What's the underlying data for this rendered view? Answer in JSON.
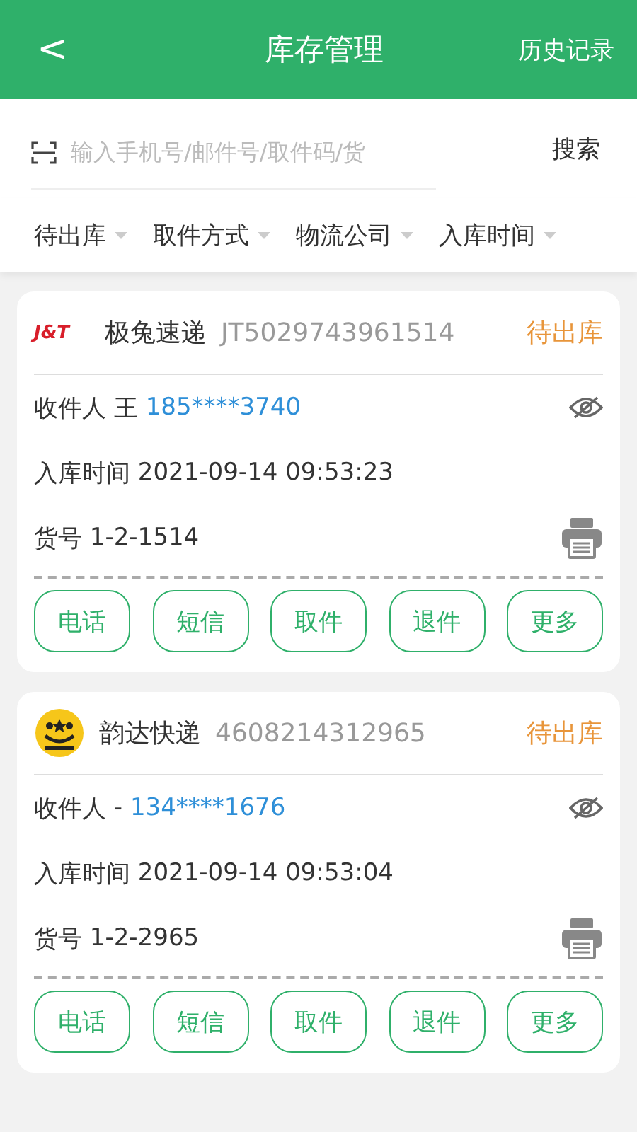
{
  "header": {
    "back": "<",
    "title": "库存管理",
    "action": "历史记录"
  },
  "search": {
    "placeholder": "输入手机号/邮件号/取件码/货",
    "button": "搜索"
  },
  "filters": [
    {
      "label": "待出库"
    },
    {
      "label": "取件方式"
    },
    {
      "label": "物流公司"
    },
    {
      "label": "入库时间"
    }
  ],
  "cards": [
    {
      "logo": {
        "kind": "jt",
        "text": "J&T"
      },
      "courier": "极兔速递",
      "tracking": "JT5029743961514",
      "status": "待出库",
      "recipient_label": "收件人",
      "recipient_name": "王",
      "phone": "185****3740",
      "time_label": "入库时间",
      "time": "2021-09-14 09:53:23",
      "code_label": "货号",
      "code": "1-2-1514",
      "buttons": [
        "电话",
        "短信",
        "取件",
        "退件",
        "更多"
      ]
    },
    {
      "logo": {
        "kind": "yunda"
      },
      "courier": "韵达快递",
      "tracking": "4608214312965",
      "status": "待出库",
      "recipient_label": "收件人",
      "recipient_name": "-",
      "phone": "134****1676",
      "time_label": "入库时间",
      "time": "2021-09-14 09:53:04",
      "code_label": "货号",
      "code": "1-2-2965",
      "buttons": [
        "电话",
        "短信",
        "取件",
        "退件",
        "更多"
      ]
    }
  ]
}
